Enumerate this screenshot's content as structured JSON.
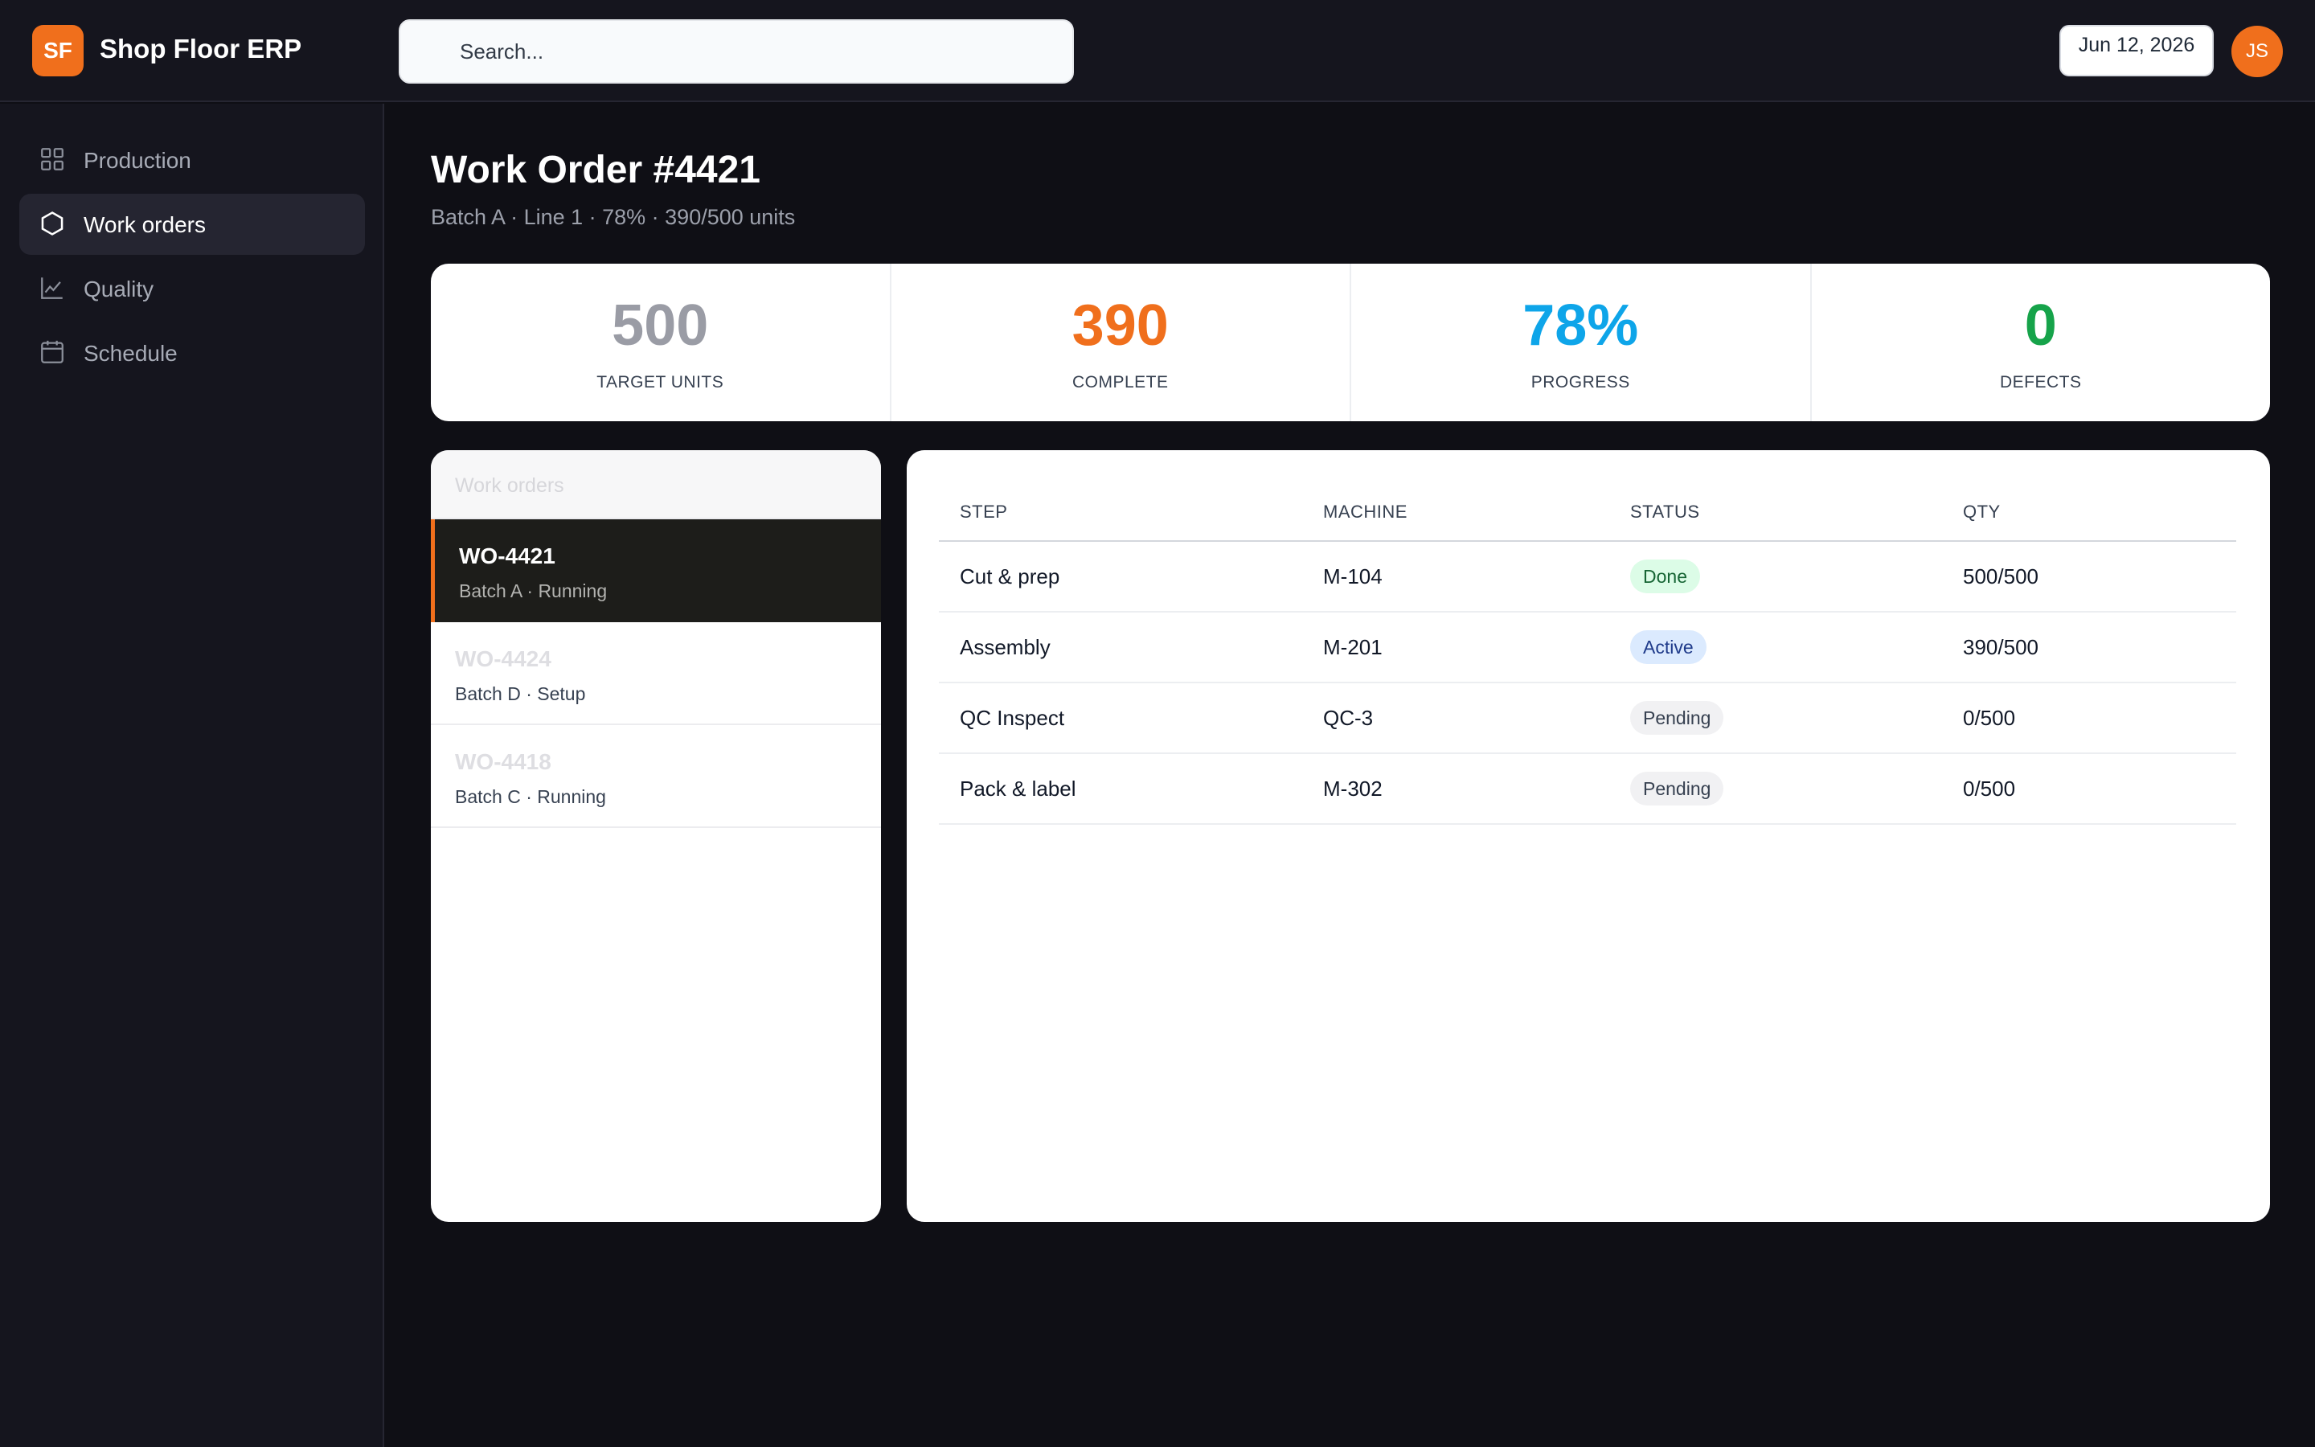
{
  "app": {
    "logo_text": "SF",
    "title": "Shop Floor ERP"
  },
  "search": {
    "placeholder": "Search..."
  },
  "header": {
    "date": "Jun 12, 2026",
    "avatar_initials": "JS"
  },
  "sidebar": {
    "items": [
      {
        "label": "Production",
        "icon": "grid-icon",
        "active": false
      },
      {
        "label": "Work orders",
        "icon": "hexagon-icon",
        "active": true
      },
      {
        "label": "Quality",
        "icon": "chart-line-icon",
        "active": false
      },
      {
        "label": "Schedule",
        "icon": "calendar-icon",
        "active": false
      }
    ]
  },
  "page": {
    "title": "Work Order #4421",
    "subtitle": "Batch A · Line 1 · 78% · 390/500 units"
  },
  "stats": [
    {
      "value": "500",
      "label": "TARGET UNITS",
      "color": "#9a9ca5"
    },
    {
      "value": "390",
      "label": "COMPLETE",
      "color": "#f06f1c"
    },
    {
      "value": "78%",
      "label": "PROGRESS",
      "color": "#0ea5e9"
    },
    {
      "value": "0",
      "label": "DEFECTS",
      "color": "#16a34a"
    }
  ],
  "work_orders": {
    "header": "Work orders",
    "items": [
      {
        "id": "WO-4421",
        "meta": "Batch A · Running",
        "selected": true
      },
      {
        "id": "WO-4424",
        "meta": "Batch D · Setup",
        "selected": false
      },
      {
        "id": "WO-4418",
        "meta": "Batch C · Running",
        "selected": false
      }
    ]
  },
  "steps_table": {
    "columns": [
      "STEP",
      "MACHINE",
      "STATUS",
      "QTY"
    ],
    "rows": [
      {
        "step": "Cut & prep",
        "machine": "M-104",
        "status": "Done",
        "qty": "500/500"
      },
      {
        "step": "Assembly",
        "machine": "M-201",
        "status": "Active",
        "qty": "390/500"
      },
      {
        "step": "QC Inspect",
        "machine": "QC-3",
        "status": "Pending",
        "qty": "0/500"
      },
      {
        "step": "Pack & label",
        "machine": "M-302",
        "status": "Pending",
        "qty": "0/500"
      }
    ]
  },
  "status_colors": {
    "Done": {
      "bg": "#dcfce7",
      "fg": "#166534"
    },
    "Active": {
      "bg": "#dbeafe",
      "fg": "#1e3a8a"
    },
    "Pending": {
      "bg": "#f1f1f3",
      "fg": "#374151"
    }
  },
  "accent_color": "#f06f1c"
}
